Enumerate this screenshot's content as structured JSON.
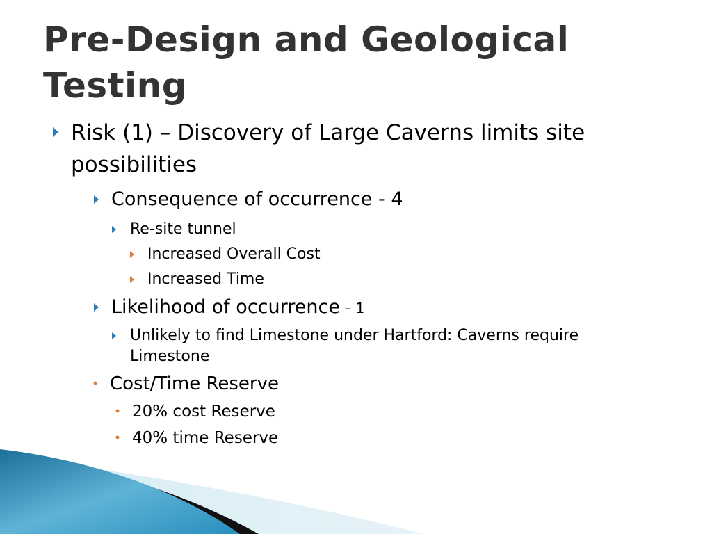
{
  "slide": {
    "title": "Pre-Design and Geological Testing",
    "bullets": [
      {
        "level": 1,
        "marker": "arrow",
        "text": "Risk (1) – Discovery of Large Caverns limits site possibilities"
      },
      {
        "level": 2,
        "marker": "arrow",
        "text": "Consequence of occurrence -  4"
      },
      {
        "level": 3,
        "marker": "arrow",
        "text": "Re-site tunnel"
      },
      {
        "level": 4,
        "marker": "arrow",
        "text": "Increased Overall Cost"
      },
      {
        "level": 4,
        "marker": "arrow",
        "text": "Increased Time"
      },
      {
        "level": 2,
        "marker": "arrow",
        "text": "Likelihood of occurrence",
        "suffix": " – 1"
      },
      {
        "level": 3,
        "marker": "arrow",
        "text": "Unlikely to find Limestone under Hartford: Caverns require Limestone"
      },
      {
        "level": 2,
        "marker": "dot",
        "text": "Cost/Time Reserve"
      },
      {
        "level": 3,
        "marker": "dot",
        "text": "20% cost Reserve"
      },
      {
        "level": 3,
        "marker": "dot",
        "text": "40% time Reserve"
      }
    ]
  },
  "colors": {
    "bullet_arrow": "#2b7fb8",
    "bullet_dot": "#e07b39",
    "title_text": "#333333"
  }
}
